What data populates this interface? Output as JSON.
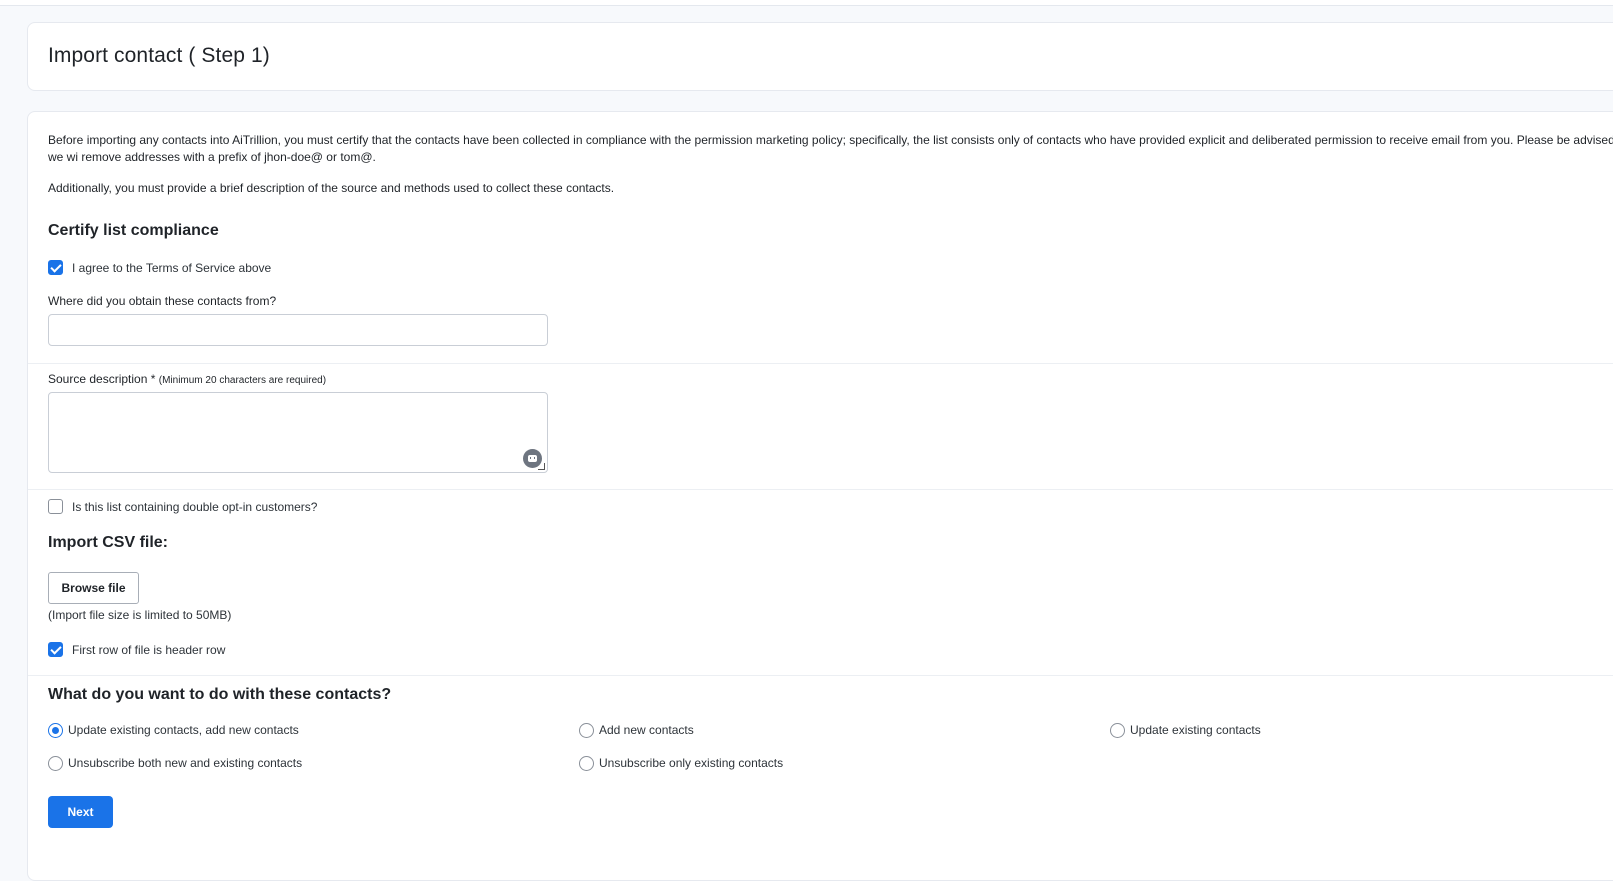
{
  "page": {
    "title": "Import contact ( Step 1)"
  },
  "intro": {
    "paragraph1": "Before importing any contacts into AiTrillion, you must certify that the contacts have been collected in compliance with the permission marketing policy; specifically, the list consists only of contacts who have provided explicit and deliberated permission to receive email from you. Please be advised we wi remove addresses with a prefix of jhon-doe@ or tom@.",
    "paragraph2": "Additionally, you must provide a brief description of the source and methods used to collect these contacts."
  },
  "compliance": {
    "heading": "Certify list compliance",
    "agree_label": "I agree to the Terms of Service above",
    "agree_checked": true,
    "source_label": "Where did you obtain these contacts from?",
    "source_value": "",
    "description_label": "Source description",
    "description_required": "*",
    "description_hint": "(Minimum 20 characters are required)",
    "description_value": "",
    "double_optin_label": "Is this list containing double opt-in customers?",
    "double_optin_checked": false
  },
  "import_csv": {
    "heading": "Import CSV file:",
    "browse_label": "Browse file",
    "size_hint": "(Import file size is limited to 50MB)",
    "header_row_label": "First row of file is header row",
    "header_row_checked": true
  },
  "actions": {
    "heading": "What do you want to do with these contacts?",
    "options": [
      {
        "label": "Update existing contacts, add new contacts",
        "selected": true
      },
      {
        "label": "Add new contacts",
        "selected": false
      },
      {
        "label": "Update existing contacts",
        "selected": false
      },
      {
        "label": "Unsubscribe both new and existing contacts",
        "selected": false
      },
      {
        "label": "Unsubscribe only existing contacts",
        "selected": false
      }
    ]
  },
  "footer": {
    "next_label": "Next"
  },
  "icons": {
    "textarea_assistant": "bot-icon",
    "textarea_resize": "resize-grip-icon"
  },
  "colors": {
    "accent": "#1a73e8"
  }
}
